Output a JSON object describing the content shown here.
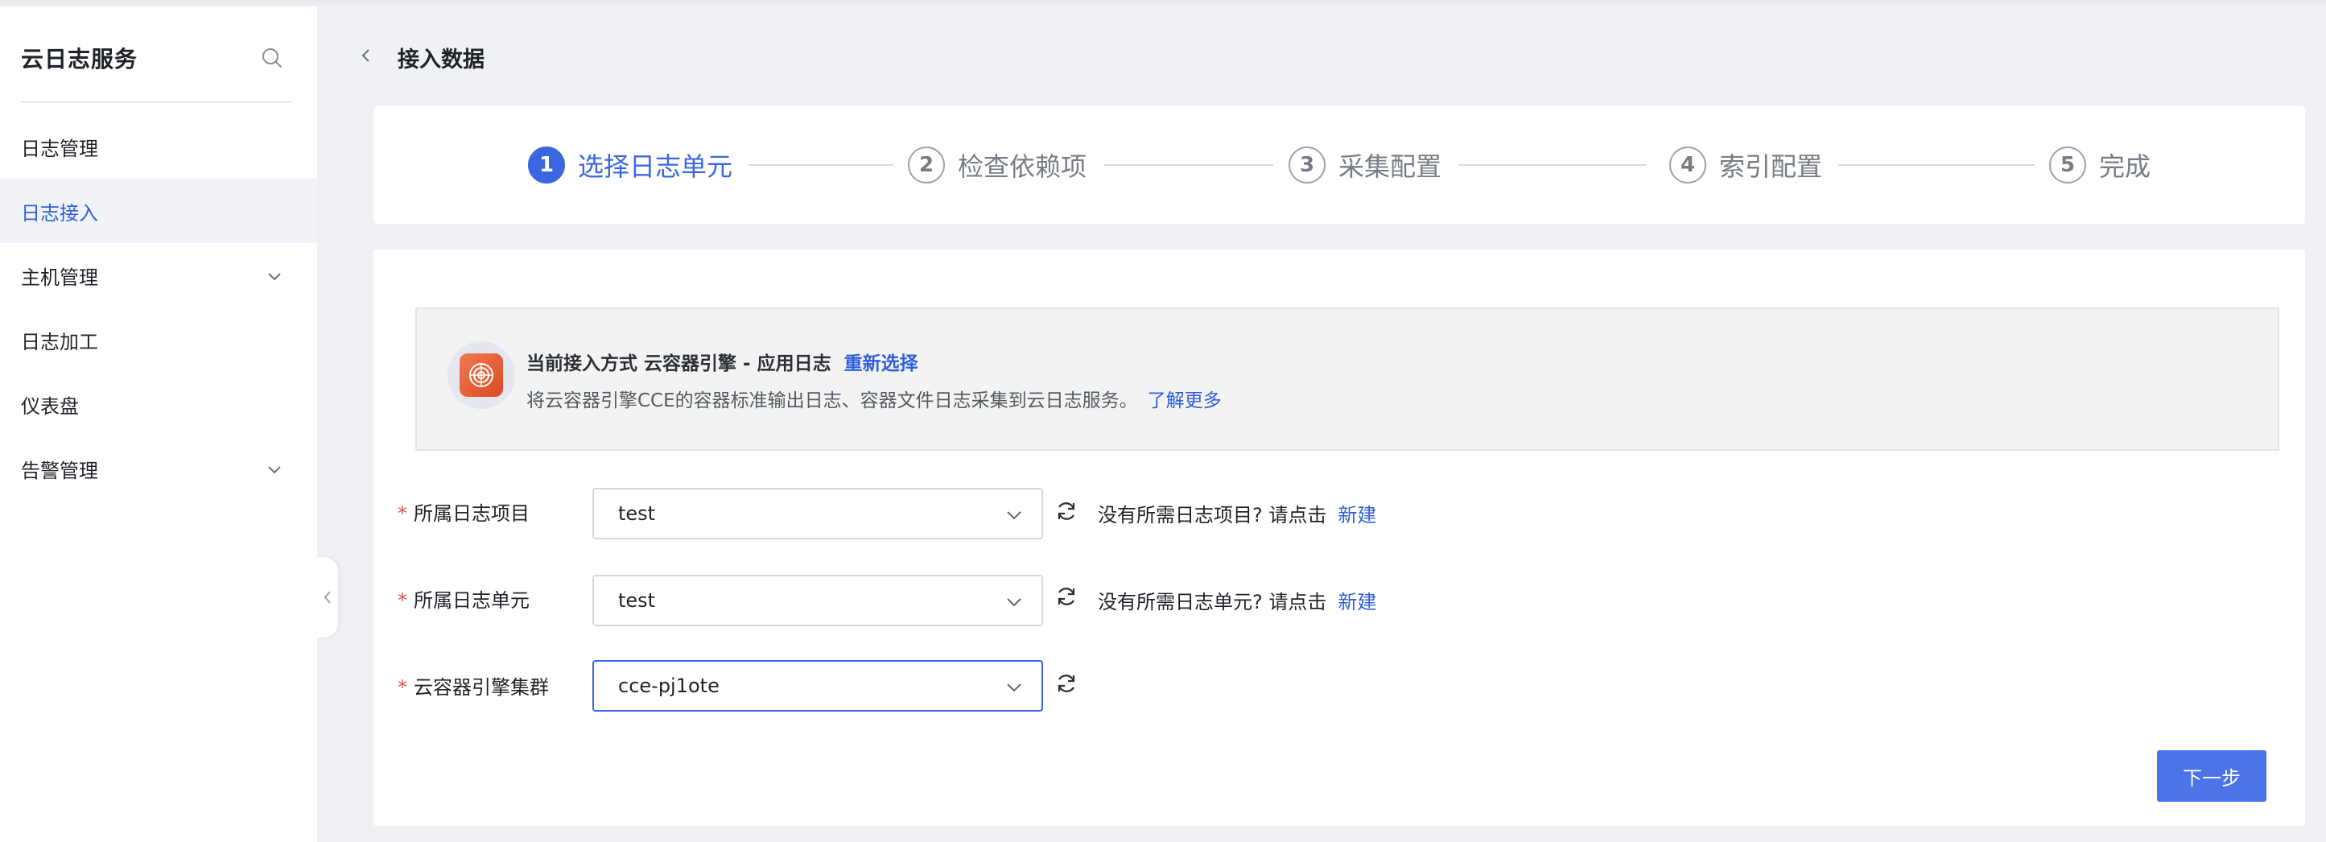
{
  "sidebar": {
    "title": "云日志服务",
    "items": [
      {
        "label": "日志管理"
      },
      {
        "label": "日志接入",
        "active": true
      },
      {
        "label": "主机管理",
        "expandable": true
      },
      {
        "label": "日志加工"
      },
      {
        "label": "仪表盘"
      },
      {
        "label": "告警管理",
        "expandable": true
      }
    ]
  },
  "header": {
    "title": "接入数据"
  },
  "steps": [
    {
      "number": "1",
      "label": "选择日志单元",
      "active": true
    },
    {
      "number": "2",
      "label": "检查依赖项"
    },
    {
      "number": "3",
      "label": "采集配置"
    },
    {
      "number": "4",
      "label": "索引配置"
    },
    {
      "number": "5",
      "label": "完成"
    }
  ],
  "info": {
    "current_method_prefix": "当前接入方式 云容器引擎 - 应用日志",
    "reselect_link": "重新选择",
    "description": "将云容器引擎CCE的容器标准输出日志、容器文件日志采集到云日志服务。",
    "learn_more_link": "了解更多"
  },
  "form": {
    "fields": [
      {
        "label": "所属日志项目",
        "value": "test",
        "hint": "没有所需日志项目? 请点击",
        "hint_link": "新建"
      },
      {
        "label": "所属日志单元",
        "value": "test",
        "hint": "没有所需日志单元? 请点击",
        "hint_link": "新建"
      },
      {
        "label": "云容器引擎集群",
        "value": "cce-pj1ote"
      }
    ],
    "required_mark": "*"
  },
  "next_button": "下一步",
  "colors": {
    "accent": "#3a66e0",
    "required": "#e34d4d",
    "link": "#2f5fd9"
  }
}
